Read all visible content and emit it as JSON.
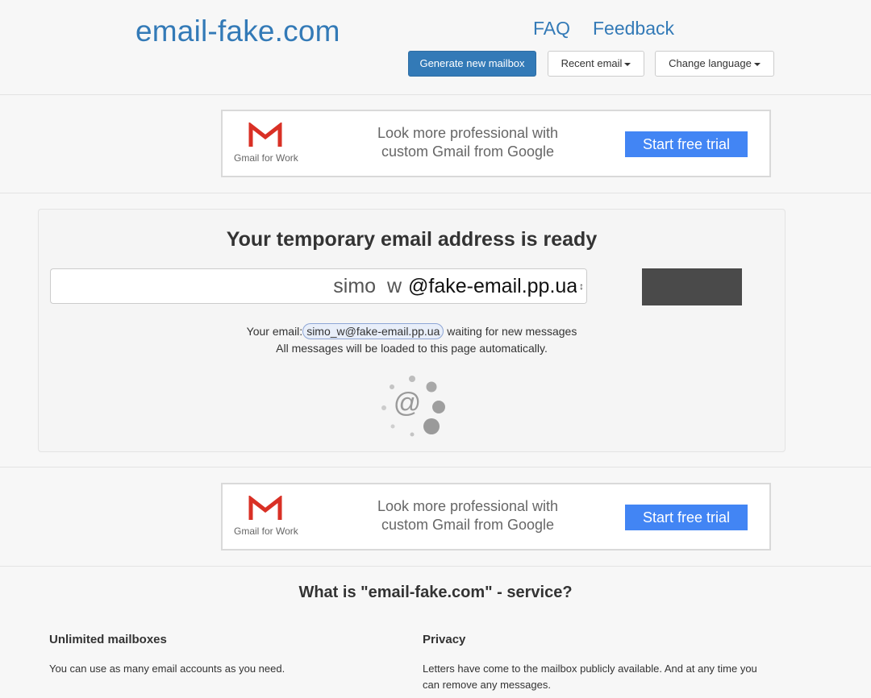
{
  "header": {
    "logo": "email-fake.com",
    "nav": {
      "faq": "FAQ",
      "feedback": "Feedback"
    },
    "buttons": {
      "generate": "Generate new mailbox",
      "recent": "Recent email",
      "language": "Change language"
    }
  },
  "ads": [
    {
      "brand": "Gmail for Work",
      "text": "Look more professional with custom Gmail from Google",
      "cta": "Start free trial"
    },
    {
      "brand": "Gmail for Work",
      "text": "Look more professional with custom Gmail from Google",
      "cta": "Start free trial"
    }
  ],
  "mailbox": {
    "title": "Your temporary email address is ready",
    "username": "simo  w",
    "domain": "@fake-email.pp.ua",
    "status_prefix": "Your email:",
    "status_email": "simo_w@fake-email.pp.ua",
    "status_suffix": "waiting for new messages",
    "status_line2": "All messages will be loaded to this page automatically.",
    "loader_symbol": "@"
  },
  "service": {
    "title": "What is \"email-fake.com\" - service?",
    "features": [
      {
        "title": "Unlimited mailboxes",
        "text": "You can use as many email accounts as you need."
      },
      {
        "title": "Privacy",
        "text": "Letters have come to the mailbox publicly available. And at any time you can remove any messages."
      }
    ]
  },
  "colors": {
    "brand": "#337ab7",
    "ad_cta": "#4285f4",
    "gmail_red": "#d93025"
  }
}
